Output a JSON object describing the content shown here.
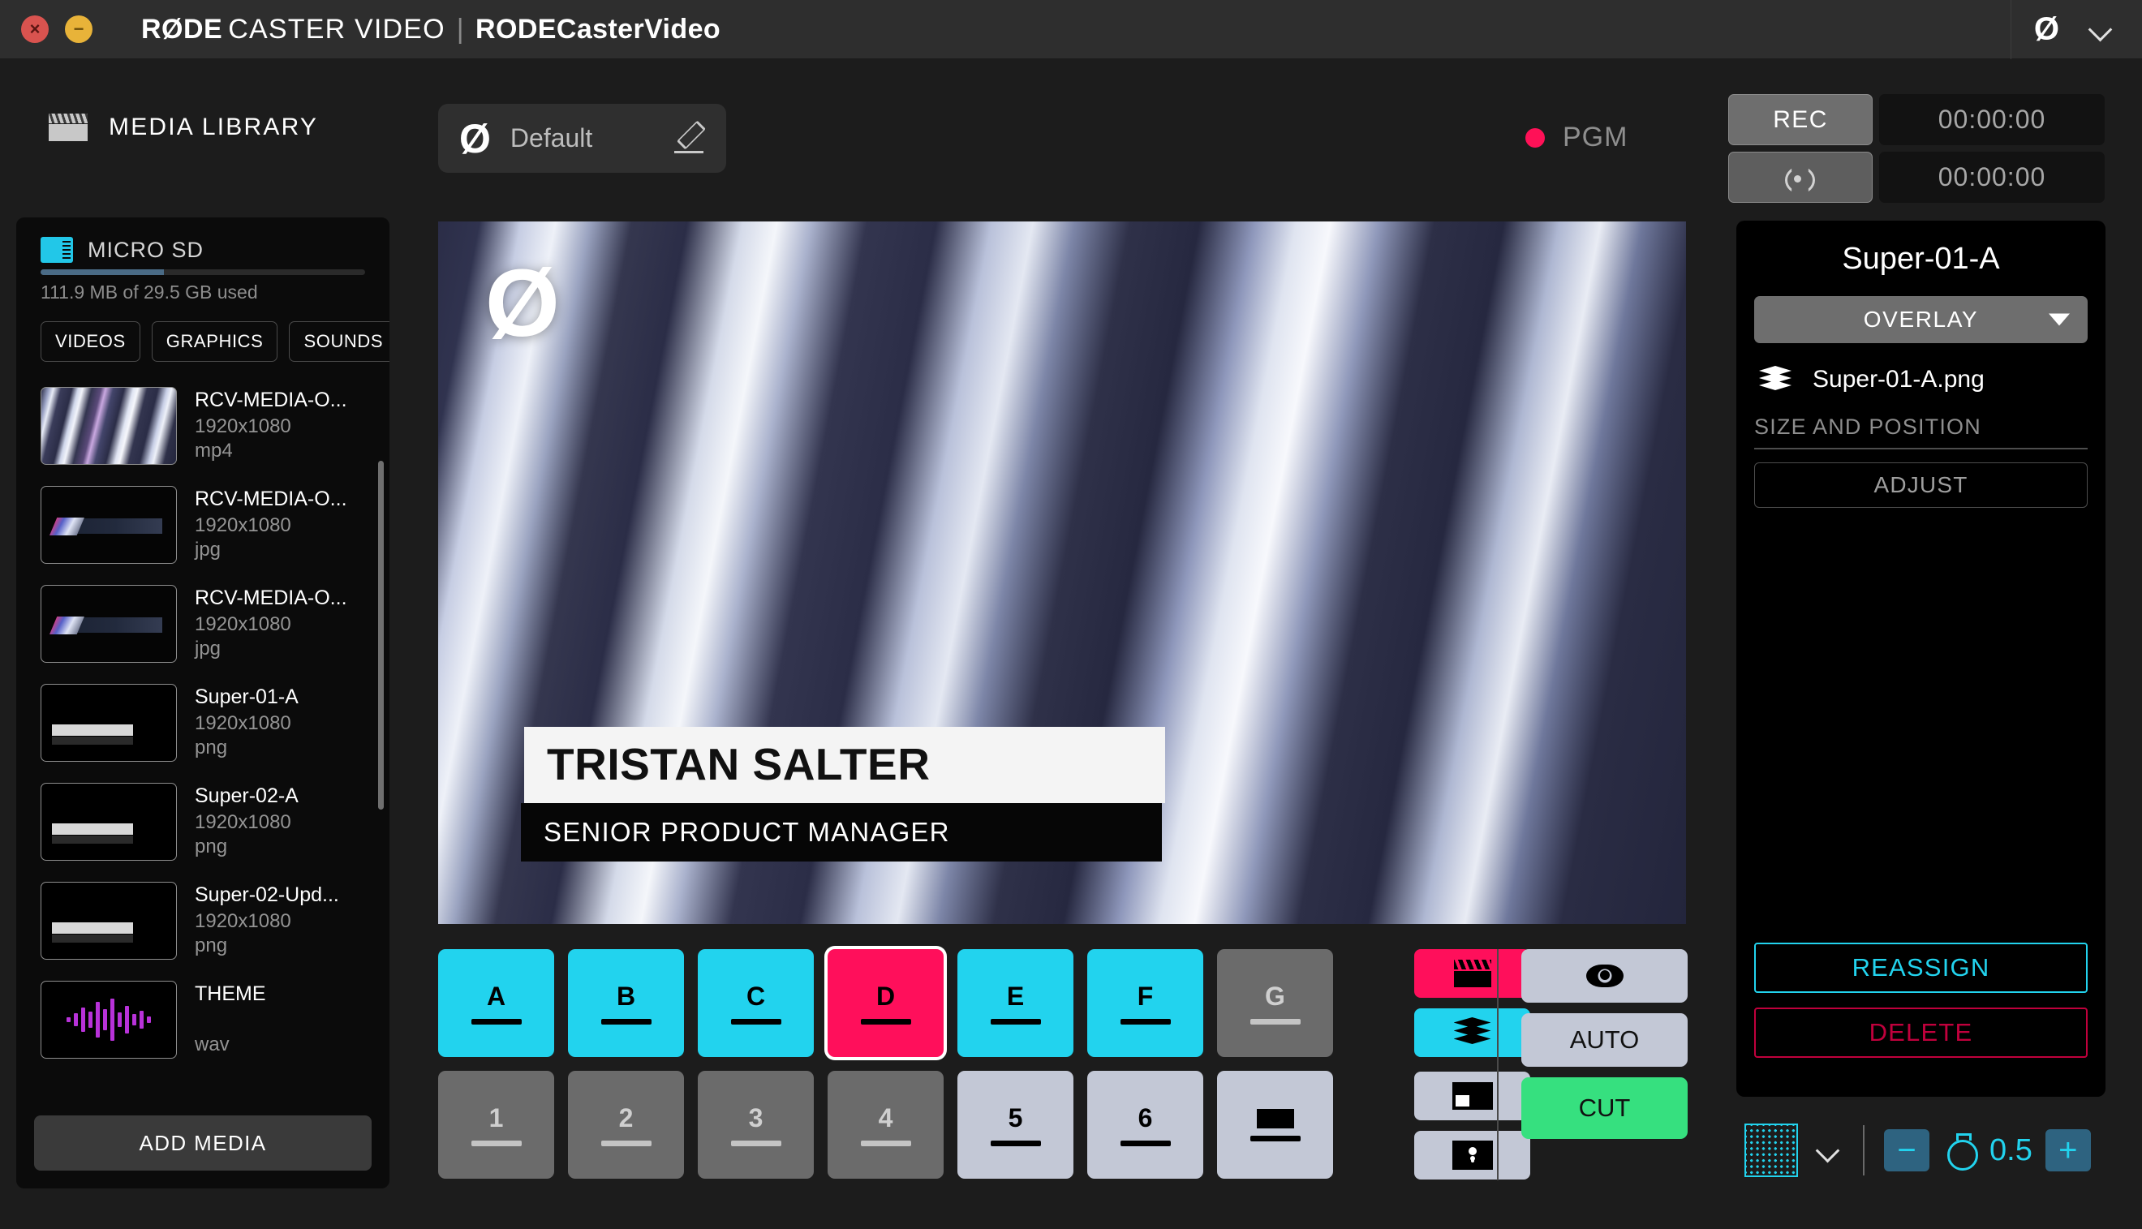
{
  "titlebar": {
    "brand_bold": "RØDE",
    "brand_light": "CASTER VIDEO",
    "separator": "|",
    "document": "RODECasterVideo",
    "close_glyph": "×",
    "minimize_glyph": "−",
    "logo_glyph": "Ø"
  },
  "media_library": {
    "header": "MEDIA LIBRARY",
    "storage": {
      "name": "MICRO SD",
      "usage": "111.9 MB of 29.5 GB used",
      "used_percent": 38
    },
    "tabs": [
      {
        "label": "VIDEOS"
      },
      {
        "label": "GRAPHICS"
      },
      {
        "label": "SOUNDS"
      }
    ],
    "files": [
      {
        "name": "RCV-MEDIA-O...",
        "dimensions": "1920x1080",
        "ext": "mp4",
        "thumb": "video"
      },
      {
        "name": "RCV-MEDIA-O...",
        "dimensions": "1920x1080",
        "ext": "jpg",
        "thumb": "lower3"
      },
      {
        "name": "RCV-MEDIA-O...",
        "dimensions": "1920x1080",
        "ext": "jpg",
        "thumb": "lower3"
      },
      {
        "name": "Super-01-A",
        "dimensions": "1920x1080",
        "ext": "png",
        "thumb": "super"
      },
      {
        "name": "Super-02-A",
        "dimensions": "1920x1080",
        "ext": "png",
        "thumb": "super"
      },
      {
        "name": "Super-02-Upd...",
        "dimensions": "1920x1080",
        "ext": "png",
        "thumb": "super"
      },
      {
        "name": "THEME",
        "dimensions": "",
        "ext": "wav",
        "thumb": "wave"
      }
    ],
    "add_media_label": "ADD MEDIA"
  },
  "scene": {
    "logo_glyph": "Ø",
    "name": "Default",
    "edit_icon": "pencil-icon"
  },
  "program": {
    "label": "PGM",
    "indicator_color": "#ff1157"
  },
  "preview": {
    "watermark_glyph": "Ø",
    "lower_third": {
      "name": "TRISTAN SALTER",
      "role": "SENIOR PRODUCT MANAGER"
    }
  },
  "record": {
    "rec_label": "REC",
    "rec_timer": "00:00:00",
    "stream_icon": "stream-icon",
    "stream_timer": "00:00:00"
  },
  "properties": {
    "title": "Super-01-A",
    "mode": "OVERLAY",
    "file_name": "Super-01-A.png",
    "section_label": "SIZE AND POSITION",
    "adjust_label": "ADJUST",
    "reassign_label": "REASSIGN",
    "delete_label": "DELETE",
    "reassign_color": "#22d3ee",
    "delete_color": "#c0003c"
  },
  "transition_bar": {
    "pattern_icon": "dot-matrix-icon",
    "chevron_icon": "chevron-down-icon",
    "minus_label": "−",
    "plus_label": "+",
    "duration": "0.5",
    "timer_icon": "stopwatch-icon"
  },
  "pads": {
    "row_top": [
      {
        "label": "A",
        "state": "cyan"
      },
      {
        "label": "B",
        "state": "cyan"
      },
      {
        "label": "C",
        "state": "cyan"
      },
      {
        "label": "D",
        "state": "pink-selected"
      },
      {
        "label": "E",
        "state": "cyan"
      },
      {
        "label": "F",
        "state": "cyan"
      },
      {
        "label": "G",
        "state": "gray"
      }
    ],
    "row_bottom": [
      {
        "label": "1",
        "state": "dark"
      },
      {
        "label": "2",
        "state": "dark"
      },
      {
        "label": "3",
        "state": "dark"
      },
      {
        "label": "4",
        "state": "dark"
      },
      {
        "label": "5",
        "state": "light"
      },
      {
        "label": "6",
        "state": "light"
      },
      {
        "label": "",
        "state": "light-blank"
      }
    ],
    "side_buttons": [
      {
        "icon": "clapperboard-icon",
        "state": "pink"
      },
      {
        "icon": "layers-icon",
        "state": "cyan"
      },
      {
        "icon": "pip-icon",
        "state": "light"
      },
      {
        "icon": "lock-icon",
        "state": "light"
      }
    ]
  },
  "transitions": {
    "preview_icon": "eye-icon",
    "auto_label": "AUTO",
    "cut_label": "CUT",
    "cut_color": "#36e07f"
  }
}
